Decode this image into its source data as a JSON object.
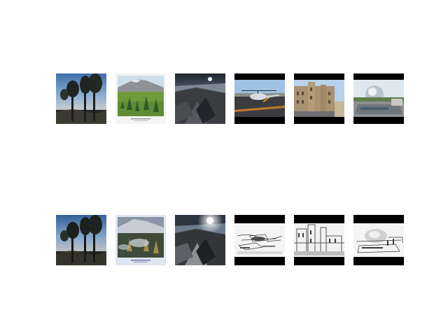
{
  "figure": {
    "rows": [
      {
        "role": "original-images",
        "tiles": [
          {
            "subject": "dusk-forest-trees"
          },
          {
            "subject": "mountain-meadow-postcard"
          },
          {
            "subject": "moonlit-rocky-landscape"
          },
          {
            "subject": "helicopter-on-helipad"
          },
          {
            "subject": "stone-castle-building"
          },
          {
            "subject": "geodesic-dome-plaza"
          }
        ]
      },
      {
        "role": "processed-images",
        "tiles": [
          {
            "subject": "dusk-forest-trees"
          },
          {
            "subject": "mountain-meadow-postcard-stylized"
          },
          {
            "subject": "moonlit-rocky-landscape-bright-moon"
          },
          {
            "subject": "helicopter-sketch-grayscale"
          },
          {
            "subject": "castle-sketch-grayscale"
          },
          {
            "subject": "dome-plaza-sketch-grayscale"
          }
        ]
      }
    ],
    "colors": {
      "background": "#ffffff",
      "letterbox": "#000000"
    }
  }
}
